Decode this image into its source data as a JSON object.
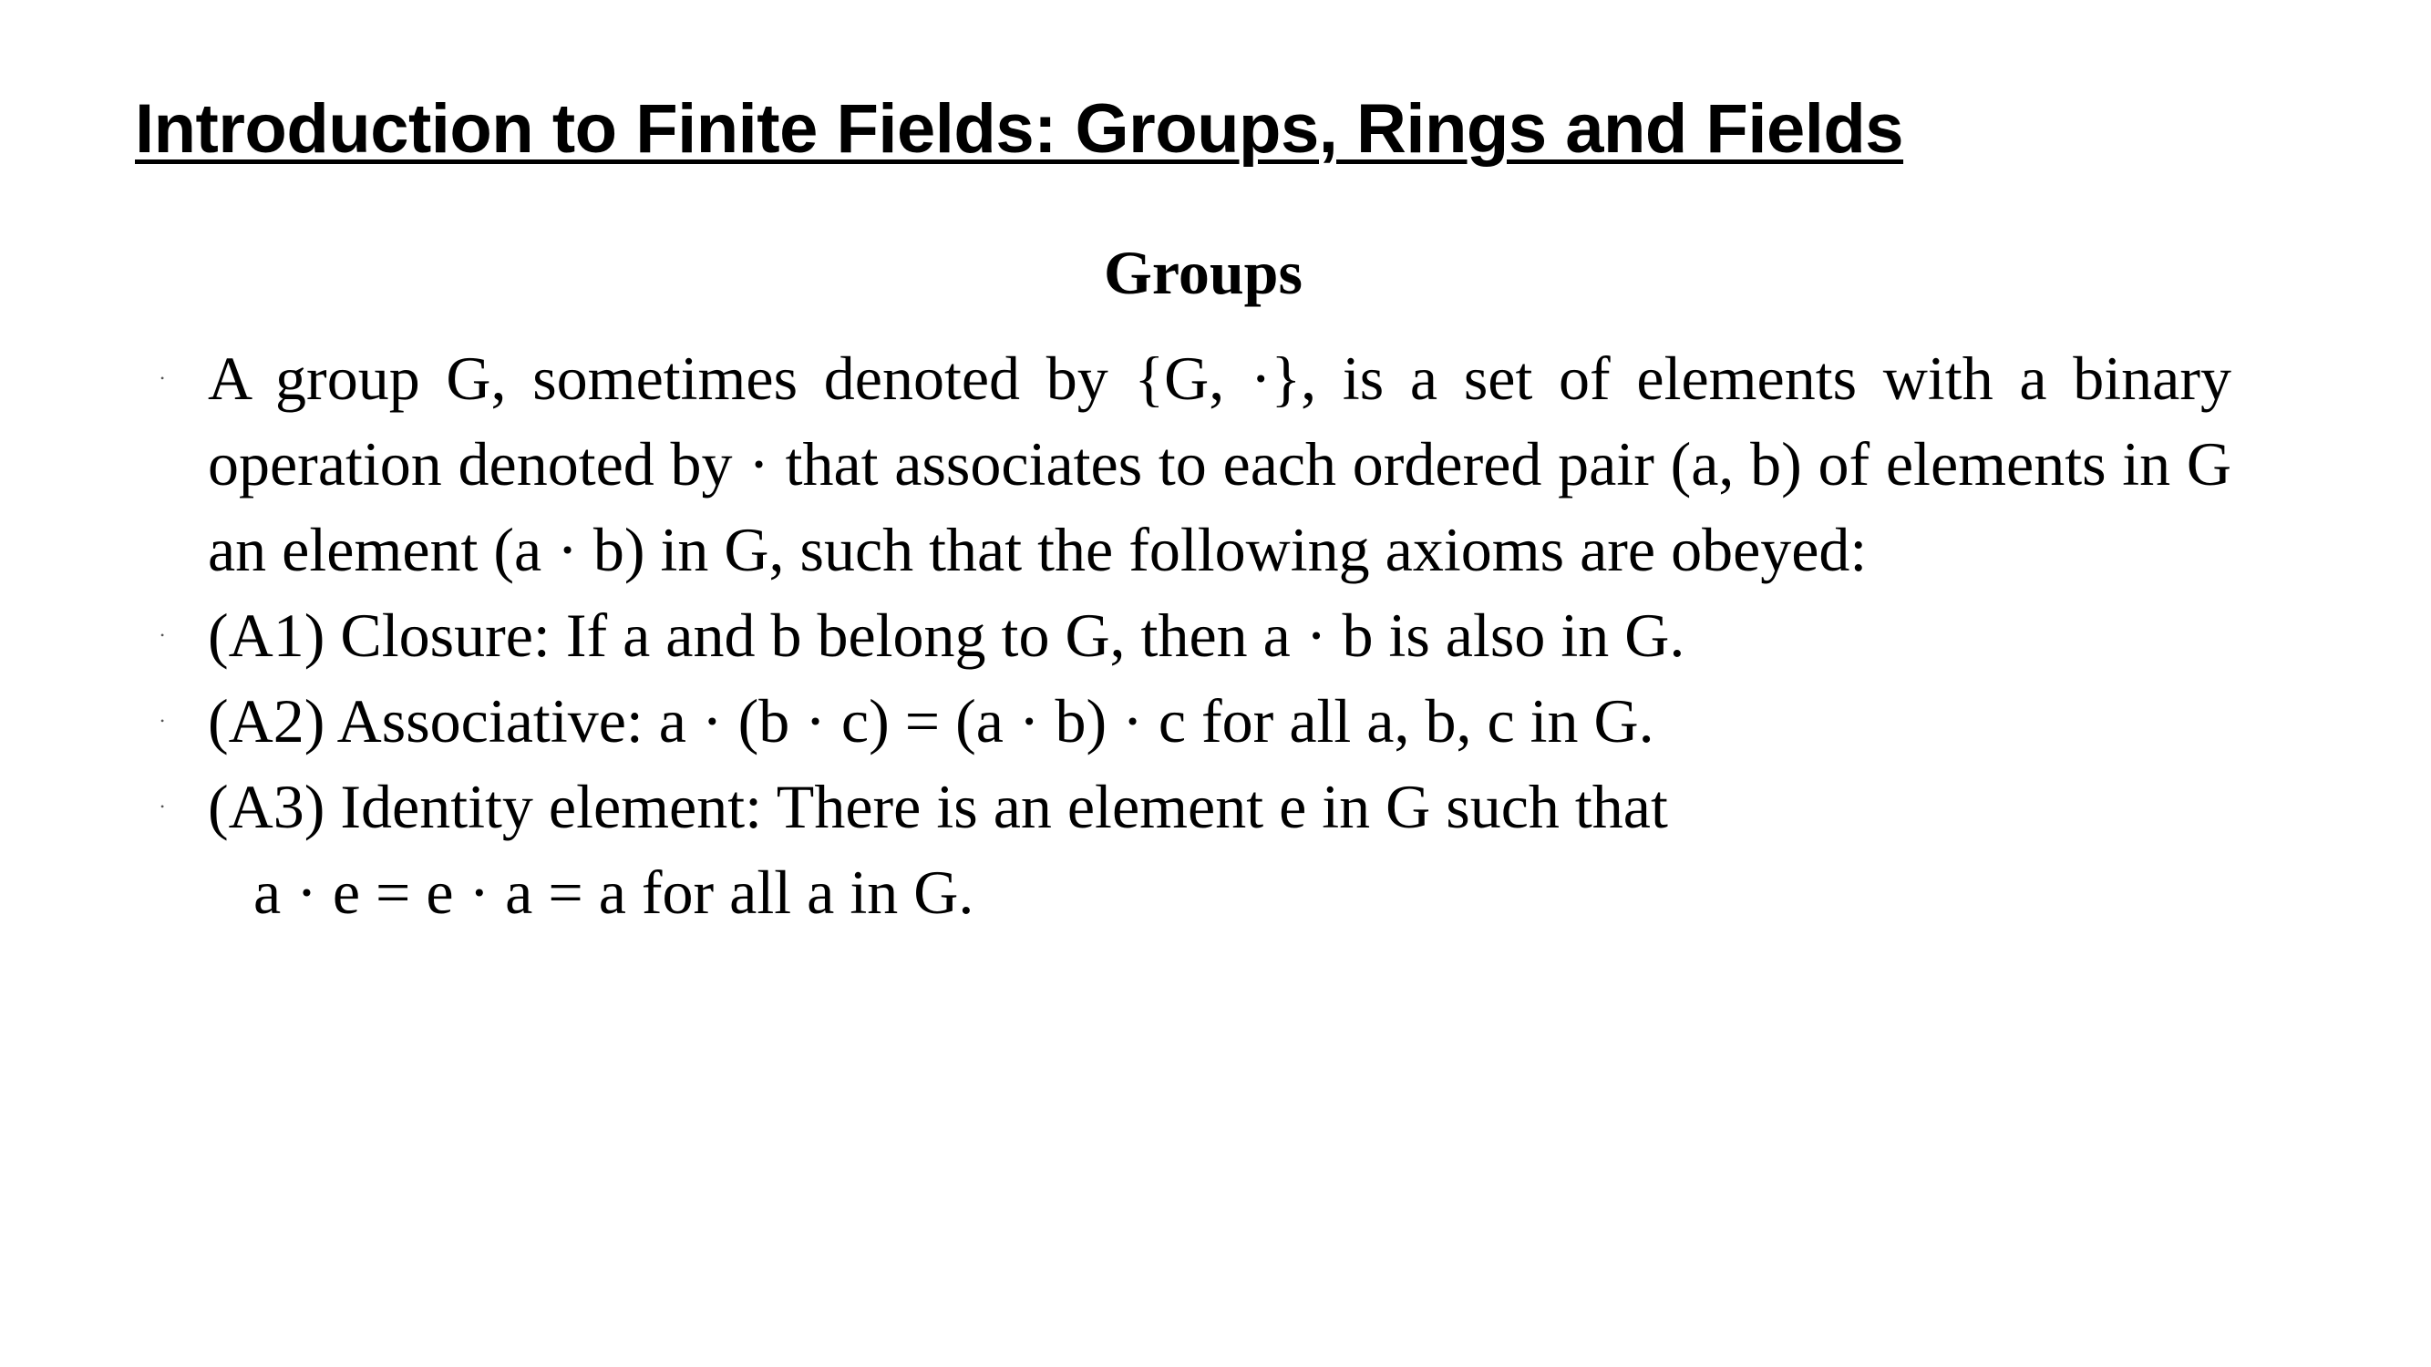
{
  "slide": {
    "title": "Introduction to Finite Fields: Groups, Rings and Fields",
    "subtitle": "Groups",
    "bullet_glyph": "•",
    "paragraphs": [
      "A group G, sometimes denoted by {G, ·}, is a set of elements with a binary operation denoted by · that associates to each ordered pair (a, b) of elements in G an element (a · b) in G, such that the following axioms are obeyed:",
      "(A1) Closure: If a and b belong to G, then a · b is also in G.",
      "(A2) Associative: a · (b · c) = (a · b) · c for all a, b, c in G.",
      "(A3) Identity element: There is an element e in G such that"
    ],
    "continuation": "a · e = e · a = a for all a in G."
  }
}
